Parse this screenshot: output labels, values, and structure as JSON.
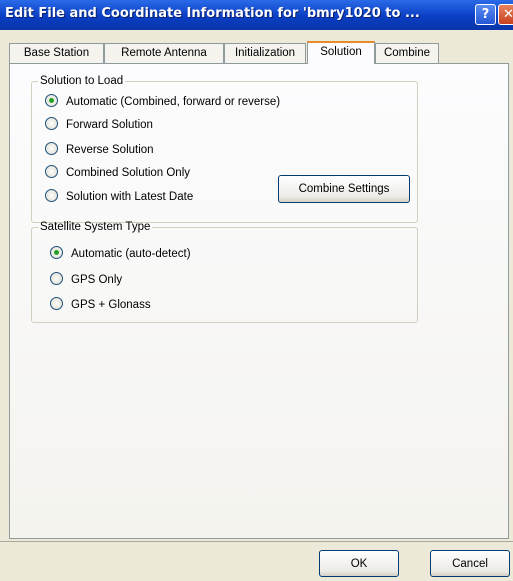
{
  "window": {
    "title": "Edit File and Coordinate Information for 'bmry1020 to ...",
    "help_glyph": "?",
    "close_glyph": "✕"
  },
  "tabs": [
    {
      "label": "Base Station",
      "active": false
    },
    {
      "label": "Remote Antenna",
      "active": false
    },
    {
      "label": "Initialization",
      "active": false
    },
    {
      "label": "Solution",
      "active": true
    },
    {
      "label": "Combine",
      "active": false
    }
  ],
  "solution_group": {
    "legend": "Solution to Load",
    "options": [
      {
        "label": "Automatic (Combined, forward or reverse)",
        "checked": true
      },
      {
        "label": "Forward Solution",
        "checked": false
      },
      {
        "label": "Reverse Solution",
        "checked": false
      },
      {
        "label": "Combined Solution Only",
        "checked": false
      },
      {
        "label": "Solution with Latest Date",
        "checked": false
      }
    ],
    "combine_settings_label": "Combine Settings"
  },
  "satellite_group": {
    "legend": "Satellite System Type",
    "options": [
      {
        "label": "Automatic (auto-detect)",
        "checked": true
      },
      {
        "label": "GPS Only",
        "checked": false
      },
      {
        "label": "GPS + Glonass",
        "checked": false
      }
    ]
  },
  "footer": {
    "ok_label": "OK",
    "cancel_label": "Cancel"
  }
}
